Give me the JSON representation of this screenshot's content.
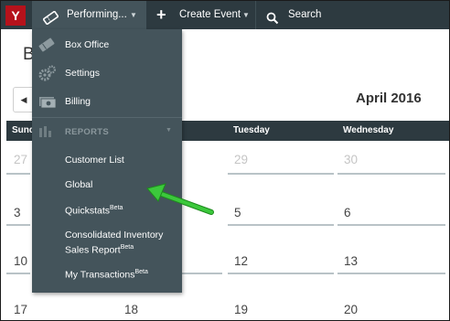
{
  "topbar": {
    "logo": "Y",
    "active_menu": "Performing...",
    "create_event": "Create Event",
    "search": "Search"
  },
  "page": {
    "title_letter": "B",
    "month_label": "April 2016",
    "days": [
      "Sunday",
      "Tuesday",
      "Wednesday"
    ],
    "day_labels_visible": {
      "sun": "Sund",
      "tue": "Tuesday",
      "wed": "Wednesday"
    },
    "week_rows": [
      {
        "sun": "27",
        "mon": "",
        "tue": "29",
        "wed": "30"
      },
      {
        "sun": "3",
        "mon": "",
        "tue": "5",
        "wed": "6"
      },
      {
        "sun": "10",
        "mon": "",
        "tue": "12",
        "wed": "13"
      },
      {
        "sun": "17",
        "mon": "18",
        "tue": "19",
        "wed": "20"
      }
    ]
  },
  "dropdown": {
    "items": [
      {
        "label": "Box Office",
        "icon": "ticket-icon"
      },
      {
        "label": "Settings",
        "icon": "gears-icon"
      },
      {
        "label": "Billing",
        "icon": "money-icon"
      }
    ],
    "section_header": "REPORTS",
    "reports": [
      {
        "label": "Customer List"
      },
      {
        "label": "Global"
      },
      {
        "label": "Quickstats",
        "sup": "Beta"
      },
      {
        "label_line1": "Consolidated Inventory",
        "label_line2": "Sales Report",
        "sup": "Beta"
      },
      {
        "label": "My Transactions",
        "sup": "Beta"
      }
    ]
  },
  "colors": {
    "topbar": "#2d3a40",
    "dropdown": "#44545b",
    "logo": "#b5121b",
    "arrow": "#3cc83c"
  }
}
